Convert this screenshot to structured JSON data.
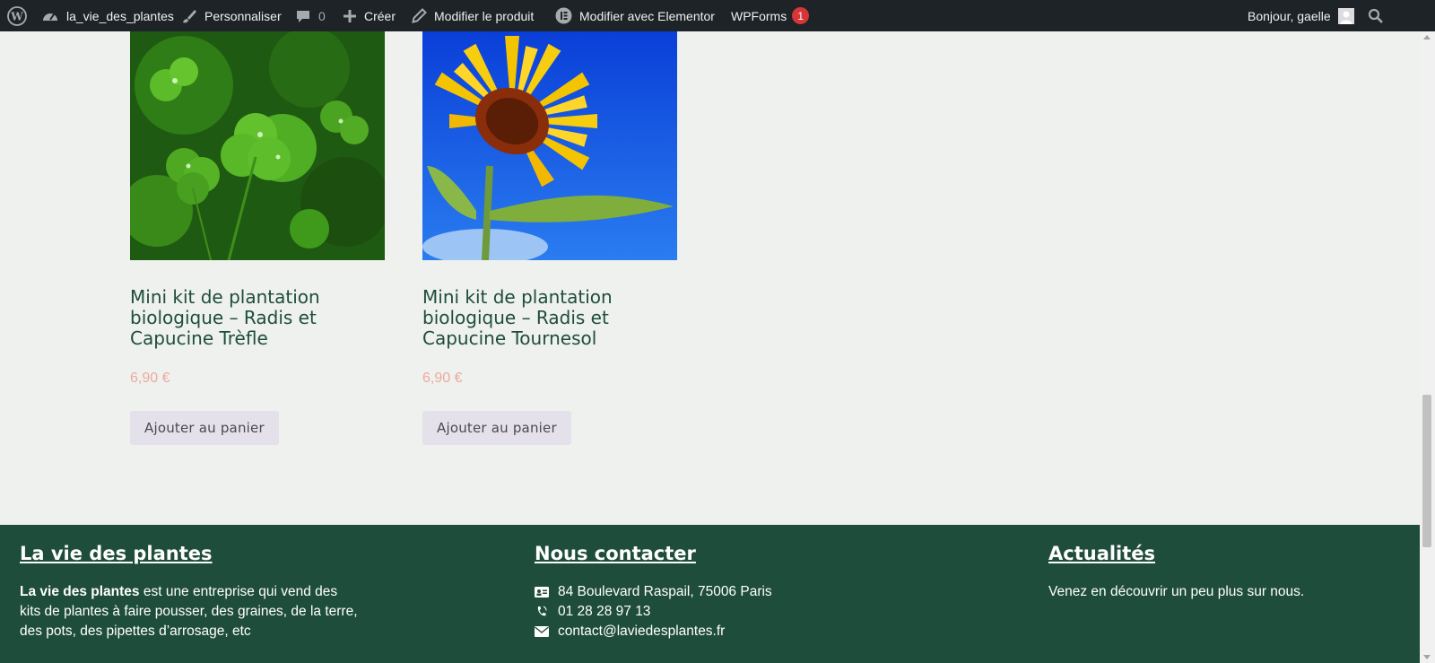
{
  "adminbar": {
    "site_name": "la_vie_des_plantes",
    "customize": "Personnaliser",
    "comments_count": "0",
    "new": "Créer",
    "edit_product": "Modifier le produit",
    "elementor": "Modifier avec Elementor",
    "wpforms": "WPForms",
    "wpforms_badge": "1",
    "greeting": "Bonjour, gaelle"
  },
  "products": [
    {
      "title": "Mini kit de plantation biologique – Radis et Capucine Trèfle",
      "price": "6,90 €",
      "button": "Ajouter au panier",
      "image": "clover-image"
    },
    {
      "title": "Mini kit de plantation biologique – Radis et Capucine Tournesol",
      "price": "6,90 €",
      "button": "Ajouter au panier",
      "image": "sunflower-image"
    }
  ],
  "footer": {
    "col1": {
      "heading": "La vie des plantes",
      "bold": "La vie des plantes",
      "text": " est une entreprise qui vend des kits de plantes à faire pousser, des graines, de la terre, des pots, des pipettes d’arrosage, etc"
    },
    "col2": {
      "heading": "Nous contacter",
      "address": "84 Boulevard Raspail, 75006 Paris",
      "phone": "01 28 28 97 13",
      "email": "contact@laviedesplantes.fr"
    },
    "col3": {
      "heading": "Actualités",
      "text": "Venez en découvrir un peu plus sur nous."
    }
  },
  "colors": {
    "adminbar": "#1d2327",
    "footer": "#1f4d3c",
    "price": "#f0a8a0",
    "title": "#1f4d3c",
    "button": "#e4e1ea"
  }
}
